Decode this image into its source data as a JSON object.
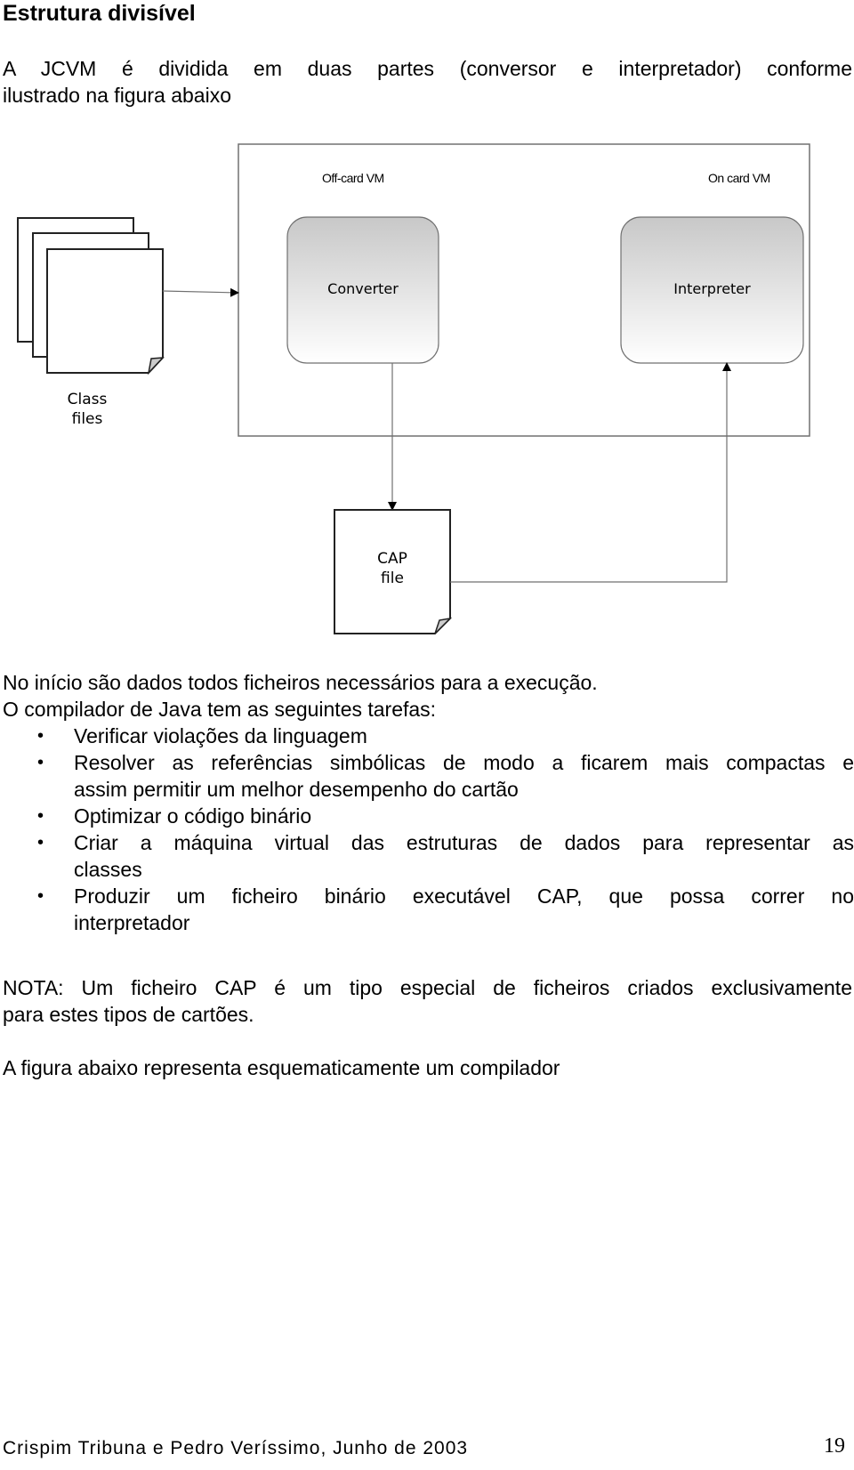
{
  "section": {
    "title": "Estrutura divisível"
  },
  "intro": {
    "line1": "A JCVM é dividida em duas partes (conversor e interpretador) conforme",
    "line2": "ilustrado na figura abaixo"
  },
  "diagram": {
    "off_card_label": "Off-card VM",
    "on_card_label": "On card VM",
    "converter_label": "Converter",
    "interpreter_label": "Interpreter",
    "class_files_label_1": "Class",
    "class_files_label_2": "files",
    "cap_file_label_1": "CAP",
    "cap_file_label_2": "file",
    "box_gradient_top": "#c8c8c8",
    "box_gradient_bottom": "#ffffff",
    "line_color": "#707070"
  },
  "body": {
    "line_start": "No início são dados todos ficheiros necessários para a execução.",
    "compiler_intro": " O compilador de Java tem as seguintes tarefas:",
    "tasks": [
      {
        "lines": [
          "Verificar violações da linguagem"
        ]
      },
      {
        "lines": [
          "Resolver as referências simbólicas de modo a ficarem mais compactas e",
          "assim permitir um melhor desempenho do cartão"
        ]
      },
      {
        "lines": [
          "Optimizar o código binário"
        ]
      },
      {
        "lines": [
          "Criar a máquina virtual das estruturas de dados para representar as",
          "classes"
        ]
      },
      {
        "lines": [
          "Produzir um ficheiro binário executável CAP, que possa correr no",
          "interpretador"
        ]
      }
    ],
    "bullet_glyph": "•",
    "note_line1": "NOTA: Um ficheiro CAP é um tipo especial de ficheiros criados exclusivamente",
    "note_line2": "para estes tipos de cartões.",
    "figure_intro": "A figura abaixo representa esquematicamente um compilador"
  },
  "footer": {
    "authors": "Crispim Tribuna e Pedro Veríssimo, Junho de 2003",
    "page_number": "19"
  }
}
